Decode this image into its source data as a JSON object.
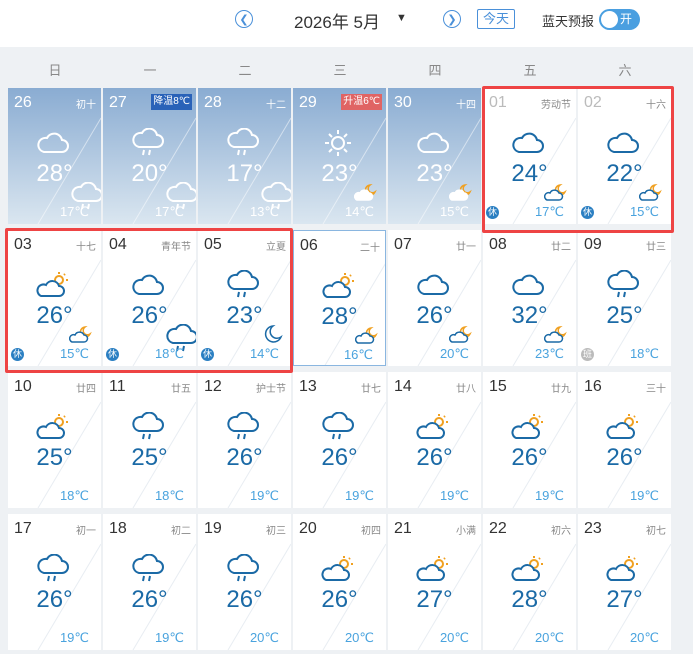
{
  "header": {
    "prev_icon": "chevron-left-icon",
    "next_icon": "chevron-right-icon",
    "year_month": "2026年 5月",
    "caret": "▼",
    "today_label": "今天",
    "forecast_label": "蓝天预报",
    "toggle_label": "开",
    "toggle_on": true
  },
  "weekdays": [
    "日",
    "一",
    "二",
    "三",
    "四",
    "五",
    "六"
  ],
  "days": [
    {
      "d": "26",
      "lunar": "初十",
      "high": "28°",
      "low": "17℃",
      "icon": "cloud",
      "nicon": "cloud-rain",
      "past": true
    },
    {
      "d": "27",
      "lunar": "",
      "badge": "降温8℃",
      "badge_type": "down",
      "high": "20°",
      "low": "17℃",
      "icon": "cloud-rain",
      "nicon": "cloud-rain",
      "past": true
    },
    {
      "d": "28",
      "lunar": "十二",
      "high": "17°",
      "low": "13℃",
      "icon": "cloud-rain",
      "nicon": "cloud-rain",
      "past": true
    },
    {
      "d": "29",
      "lunar": "",
      "badge": "升温6℃",
      "badge_type": "up",
      "high": "23°",
      "low": "14℃",
      "icon": "sun",
      "nicon": "moon-cloud",
      "past": true
    },
    {
      "d": "30",
      "lunar": "十四",
      "high": "23°",
      "low": "15℃",
      "icon": "cloud",
      "nicon": "moon-cloud",
      "past": true
    },
    {
      "d": "01",
      "lunar": "劳动节",
      "high": "24°",
      "low": "17℃",
      "icon": "cloud",
      "nicon": "moon-cloud",
      "faint": true,
      "mark": "休"
    },
    {
      "d": "02",
      "lunar": "十六",
      "high": "22°",
      "low": "15℃",
      "icon": "cloud",
      "nicon": "moon-cloud",
      "faint": true,
      "mark": "休"
    },
    {
      "d": "03",
      "lunar": "十七",
      "high": "26°",
      "low": "15℃",
      "icon": "sun-cloud",
      "nicon": "moon-cloud",
      "mark": "休"
    },
    {
      "d": "04",
      "lunar": "青年节",
      "high": "26°",
      "low": "18℃",
      "icon": "cloud",
      "nicon": "cloud-rain",
      "mark": "休"
    },
    {
      "d": "05",
      "lunar": "立夏",
      "high": "23°",
      "low": "14℃",
      "icon": "cloud-rain",
      "nicon": "moon",
      "mark": "休"
    },
    {
      "d": "06",
      "lunar": "二十",
      "high": "28°",
      "low": "16℃",
      "icon": "sun-cloud",
      "nicon": "moon-cloud",
      "today": true
    },
    {
      "d": "07",
      "lunar": "廿一",
      "high": "26°",
      "low": "20℃",
      "icon": "cloud",
      "nicon": "moon-cloud"
    },
    {
      "d": "08",
      "lunar": "廿二",
      "high": "32°",
      "low": "23℃",
      "icon": "cloud",
      "nicon": "moon-cloud"
    },
    {
      "d": "09",
      "lunar": "廿三",
      "high": "25°",
      "low": "18℃",
      "icon": "cloud-rain",
      "nicon": "",
      "mark": "班",
      "mark_type": "work"
    },
    {
      "d": "10",
      "lunar": "廿四",
      "high": "25°",
      "low": "18℃",
      "icon": "sun-cloud",
      "nicon": ""
    },
    {
      "d": "11",
      "lunar": "廿五",
      "high": "25°",
      "low": "18℃",
      "icon": "cloud-rain",
      "nicon": ""
    },
    {
      "d": "12",
      "lunar": "护士节",
      "high": "26°",
      "low": "19℃",
      "icon": "cloud-rain",
      "nicon": ""
    },
    {
      "d": "13",
      "lunar": "廿七",
      "high": "26°",
      "low": "19℃",
      "icon": "cloud-rain",
      "nicon": ""
    },
    {
      "d": "14",
      "lunar": "廿八",
      "high": "26°",
      "low": "19℃",
      "icon": "sun-cloud",
      "nicon": ""
    },
    {
      "d": "15",
      "lunar": "廿九",
      "high": "26°",
      "low": "19℃",
      "icon": "sun-cloud",
      "nicon": ""
    },
    {
      "d": "16",
      "lunar": "三十",
      "high": "26°",
      "low": "19℃",
      "icon": "sun-cloud",
      "nicon": ""
    },
    {
      "d": "17",
      "lunar": "初一",
      "high": "26°",
      "low": "19℃",
      "icon": "cloud-rain",
      "nicon": ""
    },
    {
      "d": "18",
      "lunar": "初二",
      "high": "26°",
      "low": "19℃",
      "icon": "cloud-rain",
      "nicon": ""
    },
    {
      "d": "19",
      "lunar": "初三",
      "high": "26°",
      "low": "20℃",
      "icon": "cloud-rain",
      "nicon": ""
    },
    {
      "d": "20",
      "lunar": "初四",
      "high": "26°",
      "low": "20℃",
      "icon": "sun-cloud",
      "nicon": ""
    },
    {
      "d": "21",
      "lunar": "小满",
      "high": "27°",
      "low": "20℃",
      "icon": "sun-cloud",
      "nicon": ""
    },
    {
      "d": "22",
      "lunar": "初六",
      "high": "28°",
      "low": "20℃",
      "icon": "sun-cloud",
      "nicon": ""
    },
    {
      "d": "23",
      "lunar": "初七",
      "high": "27°",
      "low": "20℃",
      "icon": "sun-cloud",
      "nicon": ""
    }
  ],
  "colors": {
    "accent": "#4a90d9",
    "highlight": "#e44444",
    "temp_high": "#1b6aa6",
    "temp_low": "#4aa3de",
    "badge_down": "#2a62b8",
    "badge_up": "#e06464"
  }
}
